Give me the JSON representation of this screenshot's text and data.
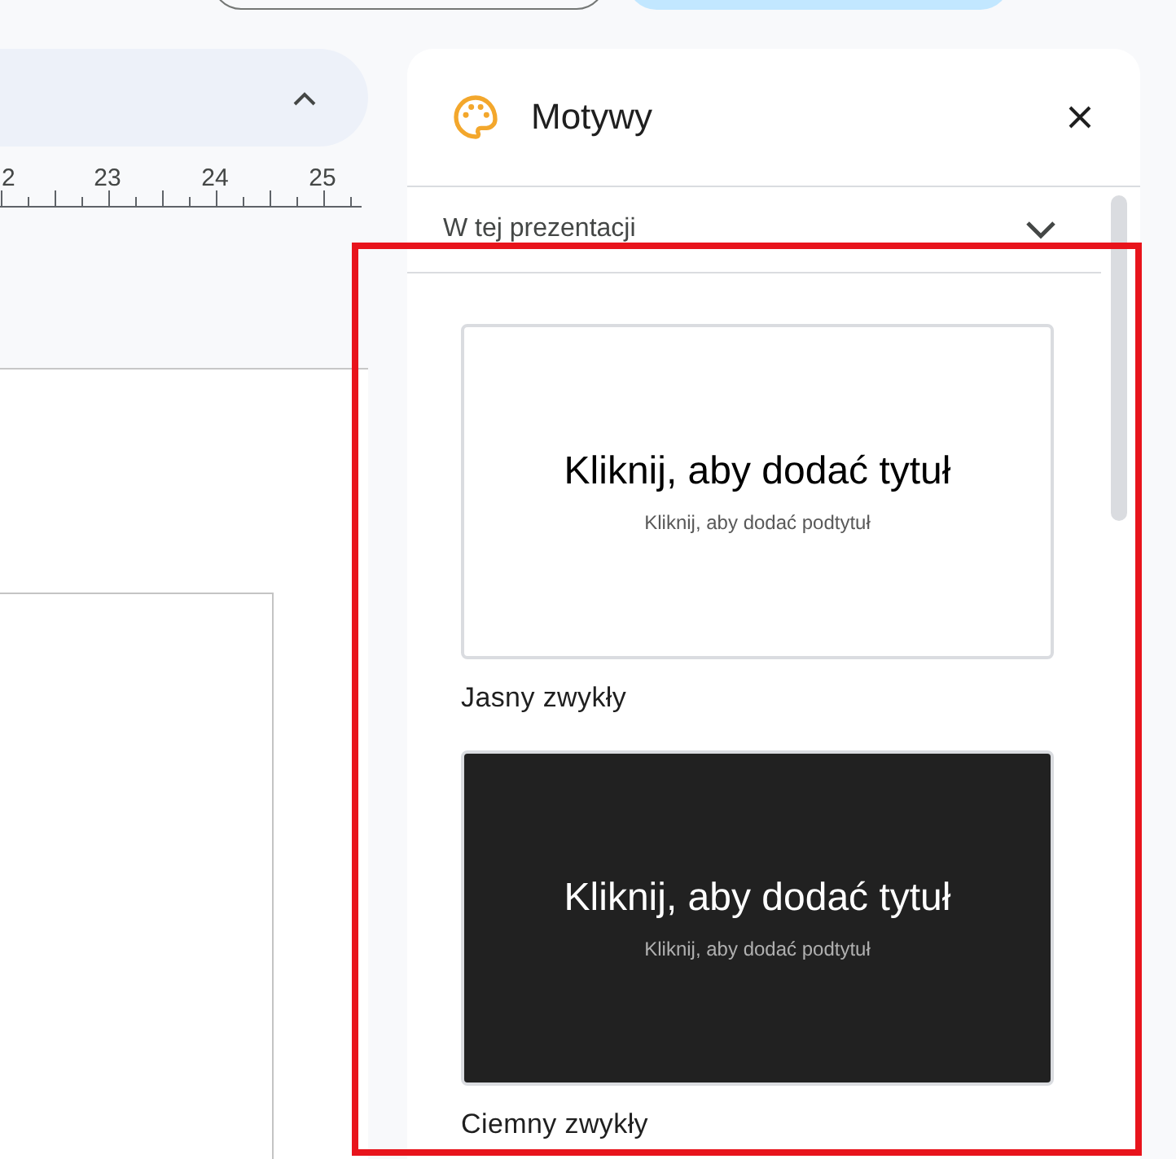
{
  "ruler": {
    "labels": [
      "2",
      "23",
      "24",
      "25"
    ]
  },
  "themes_panel": {
    "title": "Motywy",
    "filter": {
      "value": "W tej prezentacji"
    },
    "themes": [
      {
        "kind": "light",
        "name": "Jasny zwykły",
        "slide_title": "Kliknij, aby dodać tytuł",
        "slide_subtitle": "Kliknij, aby dodać podtytuł"
      },
      {
        "kind": "dark",
        "name": "Ciemny zwykły",
        "slide_title": "Kliknij, aby dodać tytuł",
        "slide_subtitle": "Kliknij, aby dodać podtytuł"
      }
    ]
  }
}
